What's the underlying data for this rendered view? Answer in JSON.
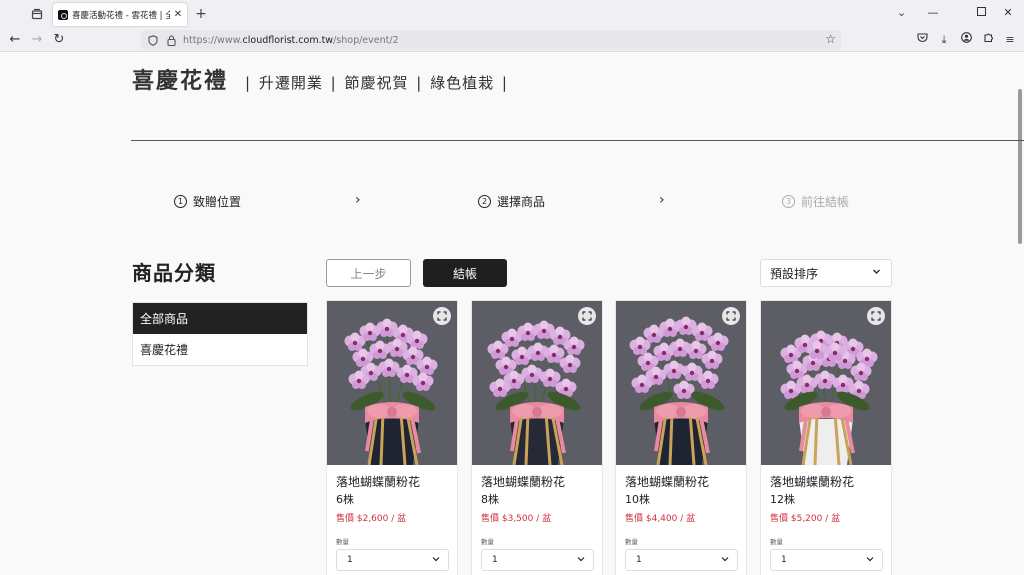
{
  "browser": {
    "tab_title": "喜慶活動花禮 - 雲花禮 | 全台花",
    "tab_close": "✕",
    "new_tab": "+",
    "url_scheme": "https://www.",
    "url_host": "cloudflorist.com.tw",
    "url_path": "/shop/event/2"
  },
  "header": {
    "title": "喜慶花禮",
    "subnav": [
      "升遷開業",
      "節慶祝賀",
      "綠色植栽"
    ],
    "separator": "|"
  },
  "steps": [
    {
      "num": "1",
      "label": "致贈位置",
      "state": "done"
    },
    {
      "num": "2",
      "label": "選擇商品",
      "state": "current"
    },
    {
      "num": "3",
      "label": "前往結帳",
      "state": "disabled"
    }
  ],
  "category": {
    "title": "商品分類",
    "items": [
      {
        "label": "全部商品",
        "active": true
      },
      {
        "label": "喜慶花禮",
        "active": false
      }
    ]
  },
  "toolbar": {
    "prev_label": "上一步",
    "checkout_label": "結帳",
    "sort_label": "預設排序"
  },
  "products": [
    {
      "name": "落地蝴蝶蘭粉花",
      "qty": "6株",
      "price": "售價 $2,600 / 盆",
      "amount_label": "數量",
      "amount_value": "1",
      "pot": "#1f2433"
    },
    {
      "name": "落地蝴蝶蘭粉花",
      "qty": "8株",
      "price": "售價 $3,500 / 盆",
      "amount_label": "數量",
      "amount_value": "1",
      "pot": "#262a36"
    },
    {
      "name": "落地蝴蝶蘭粉花",
      "qty": "10株",
      "price": "售價 $4,400 / 盆",
      "amount_label": "數量",
      "amount_value": "1",
      "pot": "#1f2433"
    },
    {
      "name": "落地蝴蝶蘭粉花",
      "qty": "12株",
      "price": "售價 $5,200 / 盆",
      "amount_label": "數量",
      "amount_value": "1",
      "pot": "#eeeeee"
    }
  ],
  "watermark": "https://hellosean.com/hellofig",
  "colors": {
    "accent_dark": "#1f1f1f",
    "price_red": "#d0313d",
    "flower_pink": "#d9a3dd",
    "ribbon_pink": "#e88aa0"
  }
}
